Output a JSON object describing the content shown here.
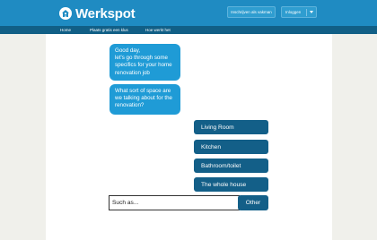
{
  "header": {
    "logo_text": "Werkspot",
    "logo_icon": "house-person-icon",
    "register_label": "Inschrijven als vakman",
    "login_label": "Inloggen",
    "colors": {
      "topbar": "#1f8bc2",
      "navbar": "#115f86"
    }
  },
  "nav": {
    "items": [
      {
        "label": "Home"
      },
      {
        "label": "Plaats gratis een klus"
      },
      {
        "label": "Hoe werkt het"
      }
    ]
  },
  "chat": {
    "messages": [
      {
        "text": "Good day,\nlet's go through some specifics for your home renovation job"
      },
      {
        "text": "What sort of space are we talking about for the renovation?"
      }
    ],
    "bubble_color": "#1f9bd6"
  },
  "options": {
    "items": [
      {
        "label": "Living Room"
      },
      {
        "label": "Kitchen"
      },
      {
        "label": "Bathroom/toilet"
      },
      {
        "label": "The whole house"
      }
    ],
    "color": "#135f88"
  },
  "custom_input": {
    "value": "Such as...",
    "button_label": "Other"
  }
}
